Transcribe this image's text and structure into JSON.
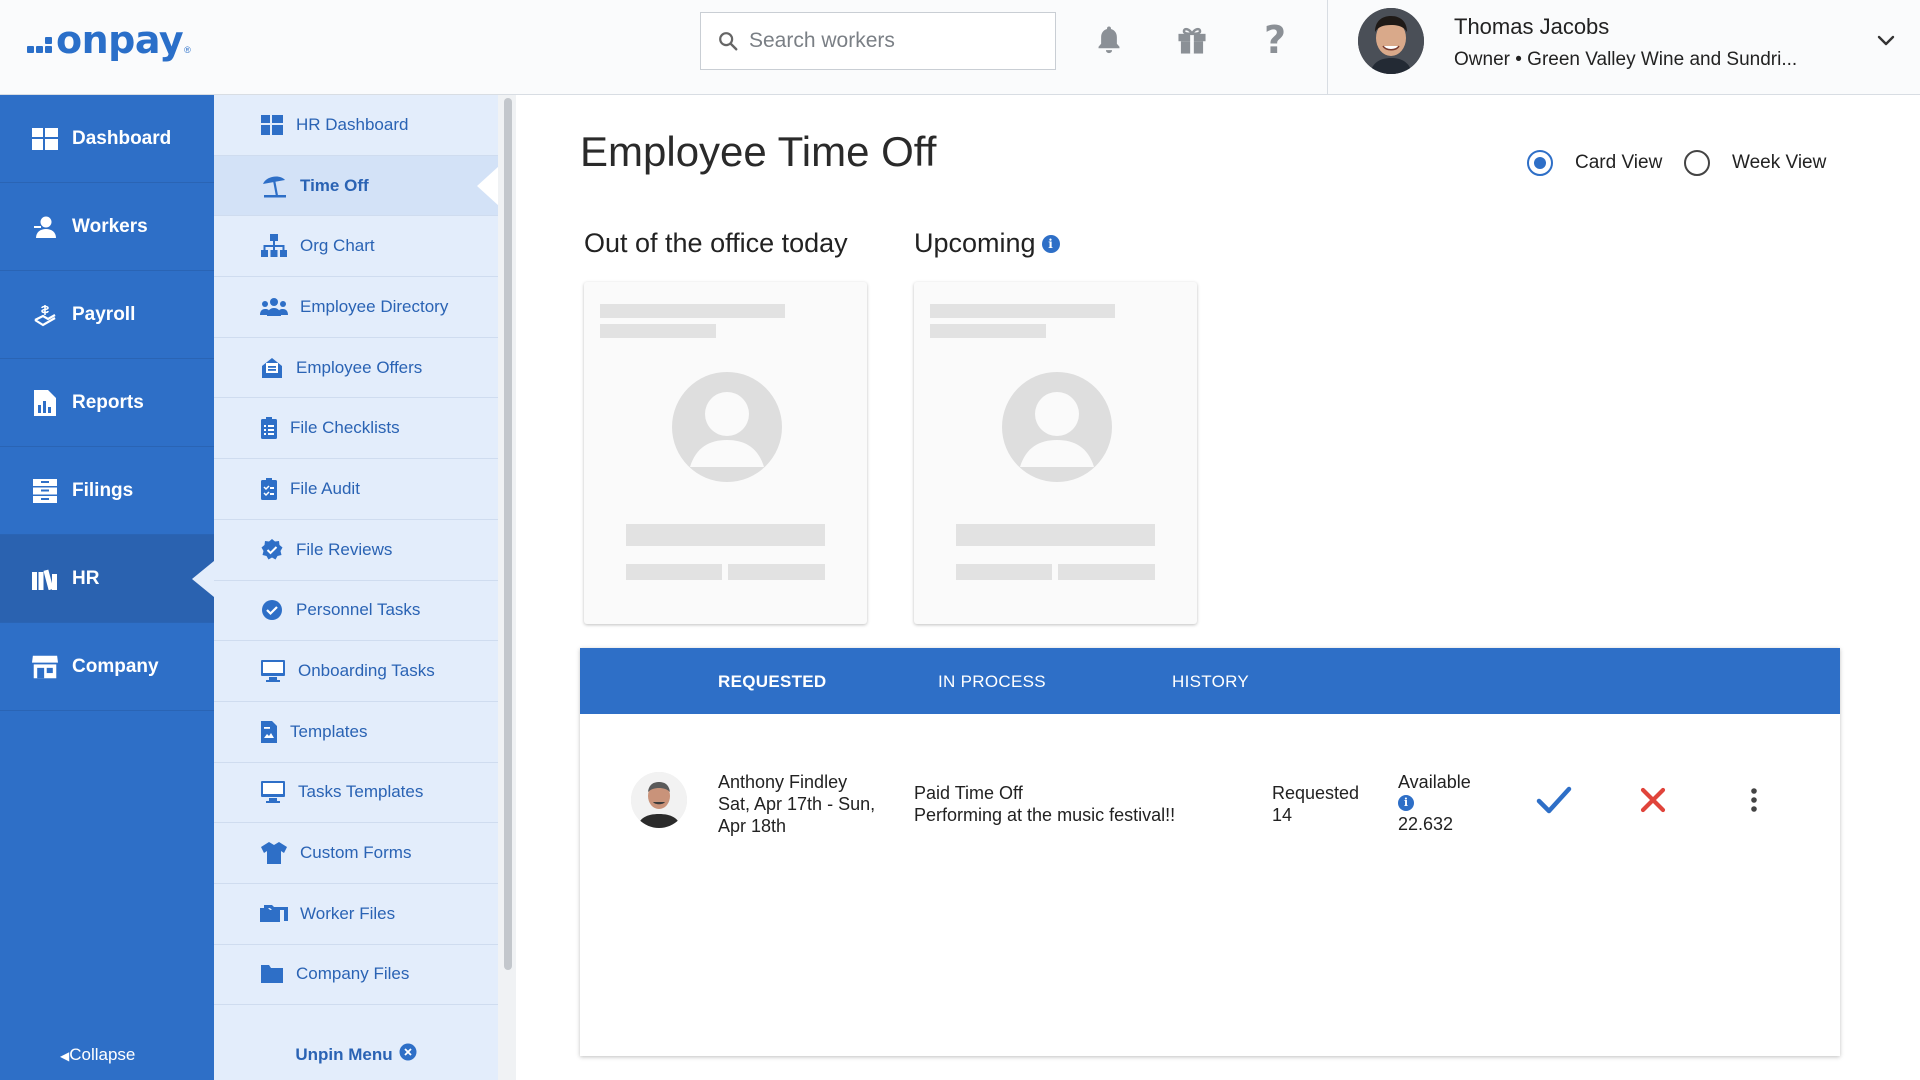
{
  "brand": {
    "name": "onpay",
    "reg": "®",
    "accent": "#2e6fc7"
  },
  "header": {
    "search_placeholder": "Search workers",
    "icons": [
      "bell-icon",
      "gift-icon",
      "help-icon"
    ],
    "user": {
      "name": "Thomas Jacobs",
      "role": "Owner • Green Valley Wine and Sundri..."
    }
  },
  "leftnav": {
    "items": [
      {
        "label": "Dashboard",
        "icon": "dashboard-icon"
      },
      {
        "label": "Workers",
        "icon": "workers-icon"
      },
      {
        "label": "Payroll",
        "icon": "payroll-icon"
      },
      {
        "label": "Reports",
        "icon": "reports-icon"
      },
      {
        "label": "Filings",
        "icon": "filings-icon"
      },
      {
        "label": "HR",
        "icon": "hr-icon",
        "active": true
      },
      {
        "label": "Company",
        "icon": "company-icon"
      }
    ],
    "collapse_label": "Collapse"
  },
  "subnav": {
    "items": [
      {
        "label": "HR Dashboard",
        "icon": "grid-icon"
      },
      {
        "label": "Time Off",
        "icon": "beach-umbrella-icon",
        "active": true
      },
      {
        "label": "Org Chart",
        "icon": "org-chart-icon"
      },
      {
        "label": "Employee Directory",
        "icon": "people-icon"
      },
      {
        "label": "Employee Offers",
        "icon": "offer-icon"
      },
      {
        "label": "File Checklists",
        "icon": "clipboard-icon"
      },
      {
        "label": "File Audit",
        "icon": "clipboard-check-icon"
      },
      {
        "label": "File Reviews",
        "icon": "badge-check-icon"
      },
      {
        "label": "Personnel Tasks",
        "icon": "check-circle-icon"
      },
      {
        "label": "Onboarding Tasks",
        "icon": "monitor-icon"
      },
      {
        "label": "Templates",
        "icon": "document-icon"
      },
      {
        "label": "Tasks Templates",
        "icon": "monitor-icon"
      },
      {
        "label": "Custom Forms",
        "icon": "shirt-icon"
      },
      {
        "label": "Worker Files",
        "icon": "folders-icon"
      },
      {
        "label": "Company Files",
        "icon": "folder-icon"
      }
    ],
    "unpin_label": "Unpin Menu"
  },
  "main": {
    "title": "Employee Time Off",
    "views": {
      "card": "Card View",
      "week": "Week View",
      "selected": "card"
    },
    "out_today_title": "Out of the office today",
    "upcoming_title": "Upcoming",
    "tabs": [
      "REQUESTED",
      "IN PROCESS",
      "HISTORY"
    ],
    "request": {
      "name": "Anthony Findley",
      "dates_line1": "Sat, Apr 17th - Sun,",
      "dates_line2": "Apr 18th",
      "type": "Paid Time Off",
      "note": "Performing at the music festival!!",
      "requested_label": "Requested",
      "requested_value": "14",
      "available_label": "Available",
      "available_value": "22.632",
      "approve_color": "#2e6fc7",
      "deny_color": "#e0443b"
    }
  }
}
